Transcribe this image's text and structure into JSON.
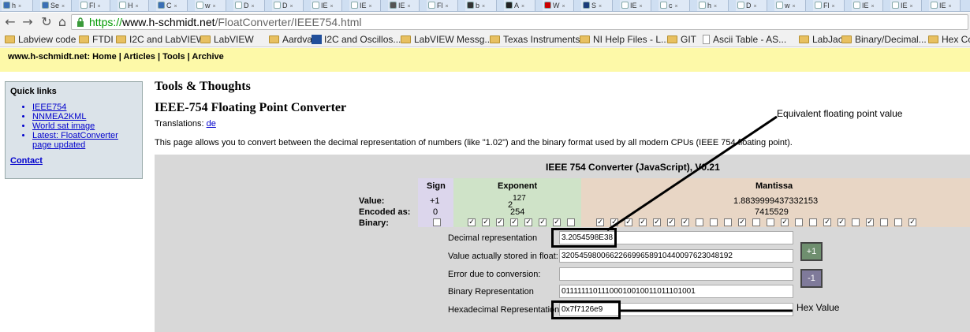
{
  "tabs": [
    {
      "label": "h",
      "color": "#3a6fb5"
    },
    {
      "label": "Se",
      "color": "#3a6fb5"
    },
    {
      "label": "Fl",
      "color": "#ffffff"
    },
    {
      "label": "H",
      "color": "#ffffff"
    },
    {
      "label": "C",
      "color": "#3a6fb5"
    },
    {
      "label": "w",
      "color": "#ffffff"
    },
    {
      "label": "D",
      "color": "#ffffff"
    },
    {
      "label": "D",
      "color": "#ffffff"
    },
    {
      "label": "IE",
      "color": "#ffffff"
    },
    {
      "label": "IE",
      "color": "#ffffff"
    },
    {
      "label": "IE",
      "color": "#555555"
    },
    {
      "label": "Fl",
      "color": "#ffffff"
    },
    {
      "label": "b",
      "color": "#333333"
    },
    {
      "label": "A",
      "color": "#222222"
    },
    {
      "label": "W",
      "color": "#cc0000"
    },
    {
      "label": "S",
      "color": "#1a3c7a"
    },
    {
      "label": "IE",
      "color": "#ffffff"
    },
    {
      "label": "c",
      "color": "#ffffff"
    },
    {
      "label": "h",
      "color": "#ffffff"
    },
    {
      "label": "D",
      "color": "#ffffff"
    },
    {
      "label": "w",
      "color": "#ffffff"
    },
    {
      "label": "Fl",
      "color": "#ffffff"
    },
    {
      "label": "IE",
      "color": "#ffffff"
    },
    {
      "label": "IE",
      "color": "#ffffff"
    },
    {
      "label": "IE",
      "color": "#ffffff"
    }
  ],
  "address": {
    "https": "https://",
    "host": "www.h-schmidt.net",
    "path": "/FloatConverter/IEEE754.html"
  },
  "bookmarks": [
    {
      "label": "Labview code",
      "icon": "folder"
    },
    {
      "label": "FTDI",
      "icon": "folder"
    },
    {
      "label": "I2C and LabVIEW",
      "icon": "folder"
    },
    {
      "label": "LabVIEW",
      "icon": "folder"
    },
    {
      "label": "Aardvark",
      "icon": "folder"
    },
    {
      "label": "I2C and Oscillos...",
      "icon": "labview"
    },
    {
      "label": "LabVIEW Messg...",
      "icon": "folder"
    },
    {
      "label": "Texas Instruments",
      "icon": "folder"
    },
    {
      "label": "NI Help Files - L...",
      "icon": "folder"
    },
    {
      "label": "GIT",
      "icon": "folder"
    },
    {
      "label": "Ascii Table - AS...",
      "icon": "doc"
    },
    {
      "label": "LabJack",
      "icon": "folder"
    },
    {
      "label": "Binary/Decimal...",
      "icon": "folder"
    },
    {
      "label": "Hex Co",
      "icon": "folder"
    }
  ],
  "site": {
    "name": "www.h-schmidt.net",
    "nav": [
      "Home",
      "Articles",
      "Tools",
      "Archive"
    ]
  },
  "quicklinks": {
    "title": "Quick links",
    "items": [
      "IEEE754",
      "NNMEA2KML",
      "World sat image",
      "Latest: FloatConverter",
      "page updated"
    ],
    "contact": "Contact"
  },
  "page": {
    "section": "Tools & Thoughts",
    "title": "IEEE-754 Floating Point Converter",
    "translations_label": "Translations:",
    "translations_link": "de",
    "intro": "This page allows you to convert between the decimal representation of numbers (like \"1.02\") and the binary format used by all modern CPUs (IEEE 754 floating point)."
  },
  "converter": {
    "title": "IEEE 754 Converter (JavaScript), V0.21",
    "headers": {
      "sign": "Sign",
      "exponent": "Exponent",
      "mantissa": "Mantissa"
    },
    "row_labels": {
      "value": "Value:",
      "encoded": "Encoded as:",
      "binary": "Binary:"
    },
    "sign": {
      "value": "+1",
      "encoded": "0"
    },
    "exponent": {
      "base": "2",
      "power": "127",
      "encoded": "254"
    },
    "mantissa": {
      "value": "1.8839999437332153",
      "encoded": "7415529"
    },
    "bits": [
      0,
      1,
      1,
      1,
      1,
      1,
      1,
      1,
      0,
      1,
      1,
      1,
      1,
      1,
      1,
      1,
      0,
      0,
      0,
      1,
      0,
      0,
      1,
      0,
      0,
      1,
      1,
      0,
      1,
      0,
      0,
      1
    ],
    "fields": [
      {
        "label": "Decimal representation",
        "value": "3.2054598E38"
      },
      {
        "label": "Value actually stored in float:",
        "value": "320545980066226699658910440097623048192"
      },
      {
        "label": "Error due to conversion:",
        "value": ""
      },
      {
        "label": "Binary Representation",
        "value": "01111111011100010010011011101001"
      },
      {
        "label": "Hexadecimal Representation",
        "value": "0x7f7126e9"
      }
    ],
    "plus_label": "+1",
    "minus_label": "-1"
  },
  "annotations": {
    "float": "Equivalent floating point value",
    "hex": "Hex Value"
  }
}
